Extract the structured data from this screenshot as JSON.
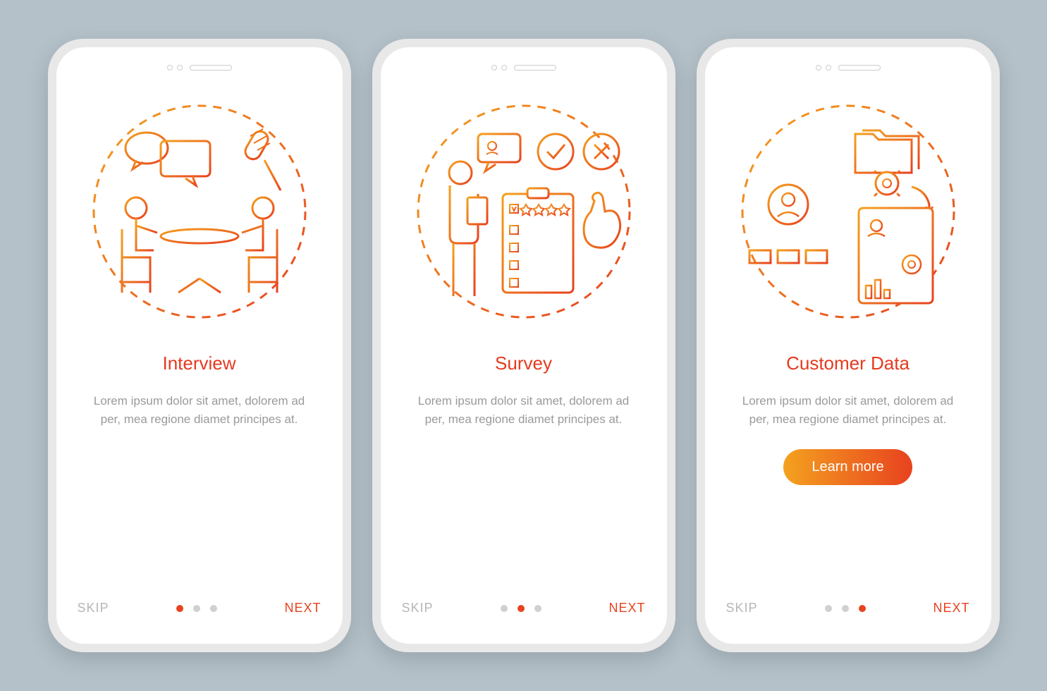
{
  "colors": {
    "accent": "#e8421f",
    "gradientStart": "#f4a11f",
    "gradientEnd": "#e8421f",
    "muted": "#9a9a9a",
    "dotInactive": "#d0d0d0"
  },
  "screens": [
    {
      "id": "interview",
      "icon": "interview-illustration",
      "title": "Interview",
      "description": "Lorem ipsum dolor sit amet, dolorem ad per, mea regione diamet principes at.",
      "skip": "SKIP",
      "next": "NEXT",
      "activeDot": 0,
      "cta": null
    },
    {
      "id": "survey",
      "icon": "survey-illustration",
      "title": "Survey",
      "description": "Lorem ipsum dolor sit amet, dolorem ad per, mea regione diamet principes at.",
      "skip": "SKIP",
      "next": "NEXT",
      "activeDot": 1,
      "cta": null
    },
    {
      "id": "customer-data",
      "icon": "customer-data-illustration",
      "title": "Customer Data",
      "description": "Lorem ipsum dolor sit amet, dolorem ad per, mea regione diamet principes at.",
      "skip": "SKIP",
      "next": "NEXT",
      "activeDot": 2,
      "cta": "Learn more"
    }
  ]
}
